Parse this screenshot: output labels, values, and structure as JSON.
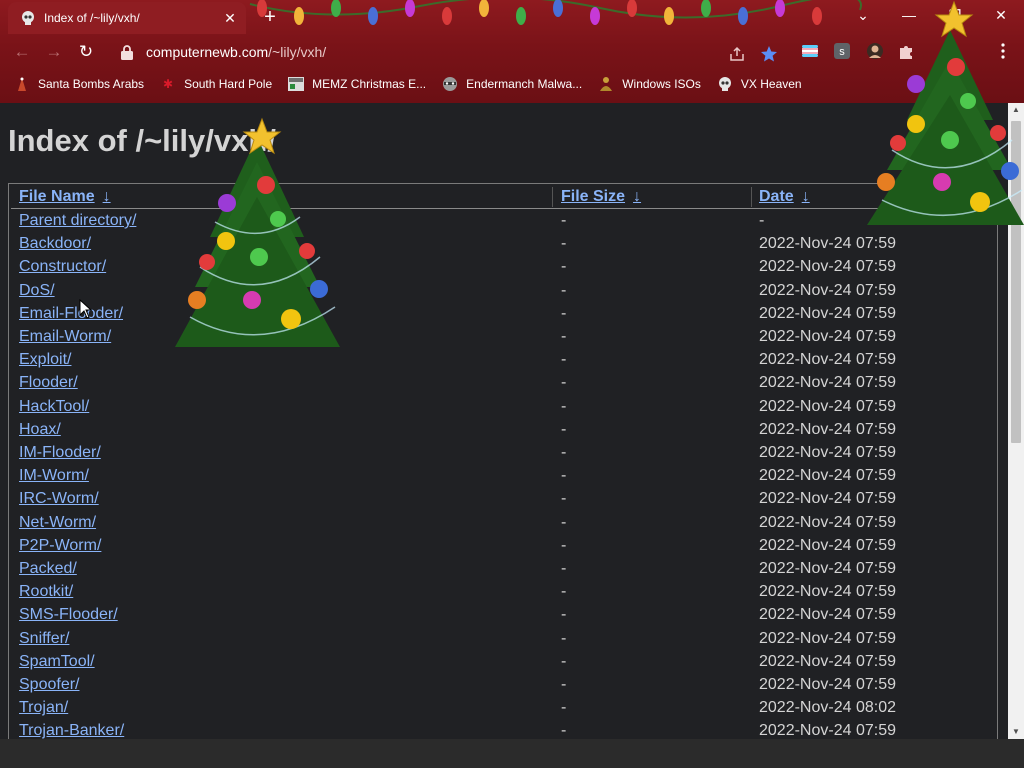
{
  "browser": {
    "tab_title": "Index of /~lily/vxh/",
    "tab_close": "✕",
    "new_tab": "+",
    "url_host": "computernewb.com",
    "url_path": "/~lily/vxh/",
    "window_controls": {
      "dropdown": "⌄",
      "minimize": "—",
      "restore": "❐",
      "close": "✕"
    },
    "nav": {
      "back": "←",
      "forward": "→",
      "reload": "↻"
    },
    "icons": [
      "lock-icon",
      "share-icon",
      "bookmark-star-icon",
      "flag-extension-icon",
      "s-extension-icon",
      "avatar-extension-icon",
      "puzzle-extensions-icon",
      "kebab-menu-icon"
    ],
    "colors": {
      "chrome_bg": "#7a1318",
      "link": "#8ab4f8",
      "page_bg": "#202124",
      "text": "#d4d4d4"
    }
  },
  "bookmarks": [
    {
      "label": "Santa Bombs Arabs",
      "icon": "santa-icon"
    },
    {
      "label": "South Hard Pole",
      "icon": "snowflake-icon"
    },
    {
      "label": "MEMZ Christmas E...",
      "icon": "page-thumb-icon"
    },
    {
      "label": "Endermanch Malwa...",
      "icon": "raccoon-icon"
    },
    {
      "label": "Windows ISOs",
      "icon": "buddha-icon"
    },
    {
      "label": "VX Heaven",
      "icon": "skull-icon"
    }
  ],
  "page": {
    "title": "Index of /~lily/vxh/",
    "columns": {
      "name": "File Name",
      "size": "File Size",
      "date": "Date",
      "sort_arrow": "↓"
    },
    "rows": [
      {
        "name": "Parent directory/",
        "size": "-",
        "date": "-"
      },
      {
        "name": "Backdoor/",
        "size": "-",
        "date": "2022-Nov-24 07:59"
      },
      {
        "name": "Constructor/",
        "size": "-",
        "date": "2022-Nov-24 07:59"
      },
      {
        "name": "DoS/",
        "size": "-",
        "date": "2022-Nov-24 07:59"
      },
      {
        "name": "Email-Flooder/",
        "size": "-",
        "date": "2022-Nov-24 07:59"
      },
      {
        "name": "Email-Worm/",
        "size": "-",
        "date": "2022-Nov-24 07:59"
      },
      {
        "name": "Exploit/",
        "size": "-",
        "date": "2022-Nov-24 07:59"
      },
      {
        "name": "Flooder/",
        "size": "-",
        "date": "2022-Nov-24 07:59"
      },
      {
        "name": "HackTool/",
        "size": "-",
        "date": "2022-Nov-24 07:59"
      },
      {
        "name": "Hoax/",
        "size": "-",
        "date": "2022-Nov-24 07:59"
      },
      {
        "name": "IM-Flooder/",
        "size": "-",
        "date": "2022-Nov-24 07:59"
      },
      {
        "name": "IM-Worm/",
        "size": "-",
        "date": "2022-Nov-24 07:59"
      },
      {
        "name": "IRC-Worm/",
        "size": "-",
        "date": "2022-Nov-24 07:59"
      },
      {
        "name": "Net-Worm/",
        "size": "-",
        "date": "2022-Nov-24 07:59"
      },
      {
        "name": "P2P-Worm/",
        "size": "-",
        "date": "2022-Nov-24 07:59"
      },
      {
        "name": "Packed/",
        "size": "-",
        "date": "2022-Nov-24 07:59"
      },
      {
        "name": "Rootkit/",
        "size": "-",
        "date": "2022-Nov-24 07:59"
      },
      {
        "name": "SMS-Flooder/",
        "size": "-",
        "date": "2022-Nov-24 07:59"
      },
      {
        "name": "Sniffer/",
        "size": "-",
        "date": "2022-Nov-24 07:59"
      },
      {
        "name": "SpamTool/",
        "size": "-",
        "date": "2022-Nov-24 07:59"
      },
      {
        "name": "Spoofer/",
        "size": "-",
        "date": "2022-Nov-24 07:59"
      },
      {
        "name": "Trojan/",
        "size": "-",
        "date": "2022-Nov-24 08:02"
      },
      {
        "name": "Trojan-Banker/",
        "size": "-",
        "date": "2022-Nov-24 07:59"
      }
    ]
  },
  "scrollbar": {
    "up": "▲",
    "down": "▼"
  }
}
